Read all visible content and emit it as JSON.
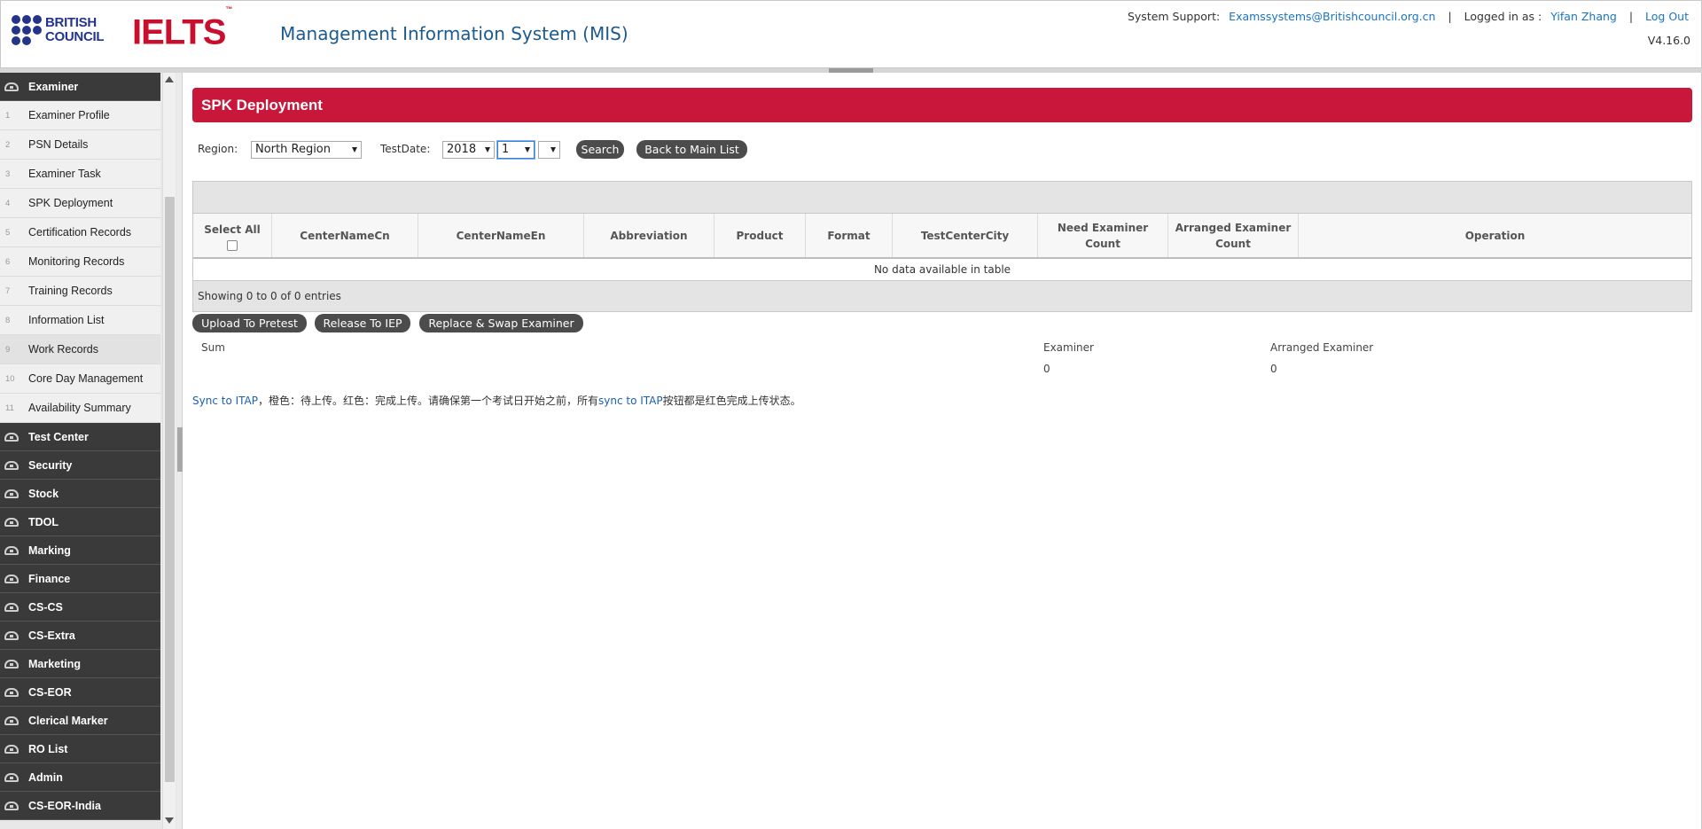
{
  "header": {
    "brand_text_line1": "BRITISH",
    "brand_text_line2": "COUNCIL",
    "ielts_text": "IELTS",
    "ielts_tm": "™",
    "app_title": "Management Information System (MIS)",
    "support_label": "System Support:",
    "support_email": "Examssystems@Britishcouncil.org.cn",
    "logged_in_label": "Logged in as :",
    "user_name": "Yifan Zhang",
    "logout_label": "Log Out",
    "separator": "|",
    "version": "V4.16.0"
  },
  "sidebar": {
    "active_group": "Examiner",
    "items": [
      {
        "num": "1",
        "label": "Examiner Profile"
      },
      {
        "num": "2",
        "label": "PSN Details"
      },
      {
        "num": "3",
        "label": "Examiner Task"
      },
      {
        "num": "4",
        "label": "SPK Deployment"
      },
      {
        "num": "5",
        "label": "Certification Records"
      },
      {
        "num": "6",
        "label": "Monitoring Records"
      },
      {
        "num": "7",
        "label": "Training Records"
      },
      {
        "num": "8",
        "label": "Information List"
      },
      {
        "num": "9",
        "label": "Work Records"
      },
      {
        "num": "10",
        "label": "Core Day Management"
      },
      {
        "num": "11",
        "label": "Availability Summary"
      }
    ],
    "groups": [
      "Test Center",
      "Security",
      "Stock",
      "TDOL",
      "Marking",
      "Finance",
      "CS-CS",
      "CS-Extra",
      "Marketing",
      "CS-EOR",
      "Clerical Marker",
      "RO List",
      "Admin",
      "CS-EOR-India"
    ]
  },
  "page": {
    "title": "SPK Deployment",
    "filters": {
      "region_label": "Region:",
      "region_value": "North Region",
      "testdate_label": "TestDate:",
      "year_value": "2018",
      "month_value": "1",
      "day_value": ""
    },
    "buttons": {
      "search": "Search",
      "back": "Back to Main List",
      "upload": "Upload To Pretest",
      "release": "Release To IEP",
      "replace": "Replace & Swap Examiner"
    },
    "table": {
      "select_all": "Select All",
      "columns": [
        "CenterNameCn",
        "CenterNameEn",
        "Abbreviation",
        "Product",
        "Format",
        "TestCenterCity",
        "Need Examiner Count",
        "Arranged Examiner Count",
        "Operation"
      ],
      "empty_text": "No data available in table",
      "info_text": "Showing 0 to 0 of 0 entries"
    },
    "summary": {
      "sum_label": "Sum",
      "examiner_label": "Examiner",
      "examiner_value": "0",
      "arranged_label": "Arranged Examiner",
      "arranged_value": "0"
    },
    "note": {
      "part1": "Sync to ITAP",
      "part2": "，橙色：待上传。红色：完成上传。请确保第一个考试日开始之前，所有",
      "part3": "sync to ITAP",
      "part4": "按钮都是红色完成上传状态。"
    }
  },
  "colors": {
    "banner": "#c8173a",
    "brand_blue": "#23358b",
    "ielts_red": "#c8102e",
    "sidebar_dark": "#3a3a3a",
    "link_blue": "#1a73c7"
  }
}
